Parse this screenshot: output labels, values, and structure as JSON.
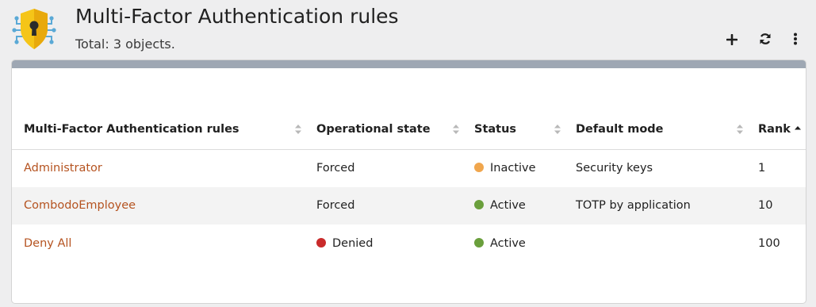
{
  "header": {
    "title": "Multi-Factor Authentication rules",
    "subtitle": "Total: 3 objects.",
    "icons": [
      "shield-lock-icon",
      "plus-icon",
      "refresh-icon",
      "more-vertical-icon"
    ]
  },
  "colors": {
    "link": "#b55320",
    "status_inactive": "#f0a64d",
    "status_active": "#6a9f3c",
    "state_denied": "#c92b2b",
    "panel_bar": "#9ea7b3"
  },
  "table": {
    "columns": [
      "Multi-Factor Authentication rules",
      "Operational state",
      "Status",
      "Default mode",
      "Rank"
    ],
    "sorted_column": "Rank",
    "sort_direction": "ascending",
    "rows": [
      {
        "name": "Administrator",
        "state": "Forced",
        "state_icon": "",
        "status": "Inactive",
        "status_icon": "inactive",
        "mode": "Security keys",
        "rank": "1"
      },
      {
        "name": "CombodoEmployee",
        "state": "Forced",
        "state_icon": "",
        "status": "Active",
        "status_icon": "active",
        "mode": "TOTP by application",
        "rank": "10"
      },
      {
        "name": "Deny All",
        "state": "Denied",
        "state_icon": "denied",
        "status": "Active",
        "status_icon": "active",
        "mode": "",
        "rank": "100"
      }
    ]
  }
}
